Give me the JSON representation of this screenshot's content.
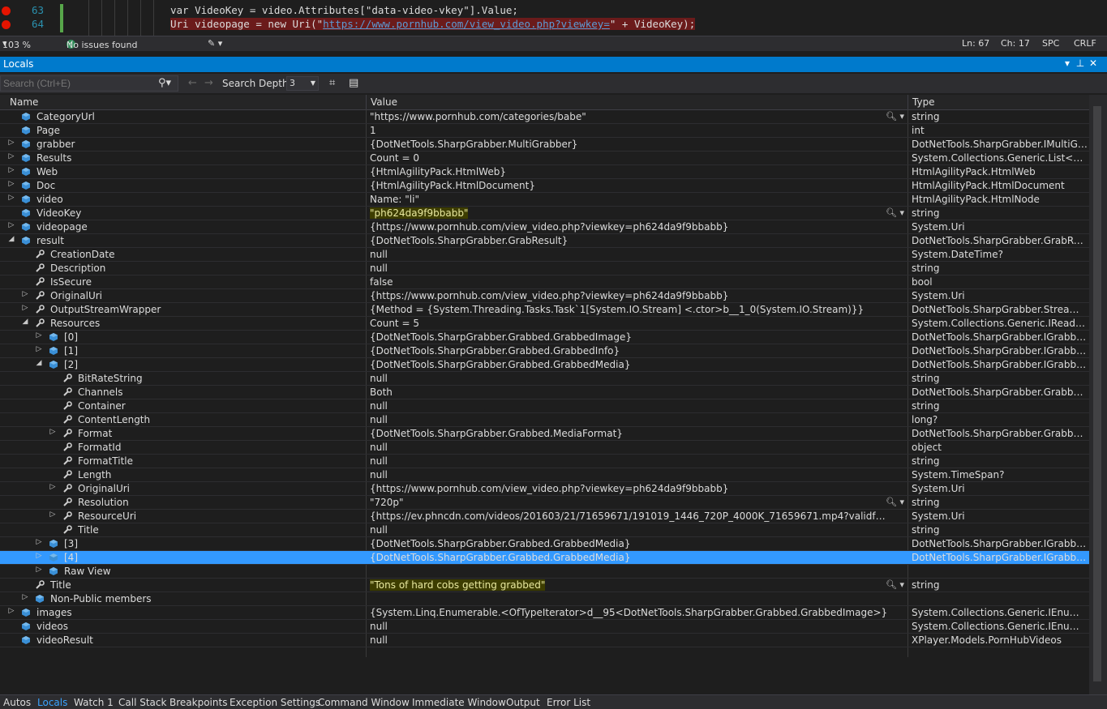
{
  "editor": {
    "lines": [
      {
        "num": "63",
        "code": "var VideoKey = video.Attributes[\"data-video-vkey\"].Value;"
      },
      {
        "num": "64",
        "code_prefix": "Uri videopage = new Uri(\"",
        "code_url": "https://www.pornhub.com/view_video.php?viewkey=",
        "code_suffix": "\" + VideoKey);"
      }
    ],
    "zoom": "103 %",
    "issues": "No issues found",
    "ln": "Ln: 67",
    "ch": "Ch: 17",
    "spc": "SPC",
    "crlf": "CRLF"
  },
  "locals": {
    "title": "Locals",
    "search_placeholder": "Search (Ctrl+E)",
    "search_depth_label": "Search Depth:",
    "search_depth_value": "3",
    "columns": {
      "name": "Name",
      "value": "Value",
      "type": "Type"
    },
    "rows": [
      {
        "name": "CategoryUrl",
        "value": "\"https://www.pornhub.com/categories/babe\"",
        "type": "string",
        "depth": 0,
        "expand": "",
        "icon": "field",
        "magnify": true
      },
      {
        "name": "Page",
        "value": "1",
        "type": "int",
        "depth": 0,
        "expand": "",
        "icon": "field"
      },
      {
        "name": "grabber",
        "value": "{DotNetTools.SharpGrabber.MultiGrabber}",
        "type": "DotNetTools.SharpGrabber.IMultiGrabb...",
        "depth": 0,
        "expand": "collapsed",
        "icon": "field"
      },
      {
        "name": "Results",
        "value": "Count = 0",
        "type": "System.Collections.Generic.List<XPlaye...",
        "depth": 0,
        "expand": "collapsed",
        "icon": "field"
      },
      {
        "name": "Web",
        "value": "{HtmlAgilityPack.HtmlWeb}",
        "type": "HtmlAgilityPack.HtmlWeb",
        "depth": 0,
        "expand": "collapsed",
        "icon": "field"
      },
      {
        "name": "Doc",
        "value": "{HtmlAgilityPack.HtmlDocument}",
        "type": "HtmlAgilityPack.HtmlDocument",
        "depth": 0,
        "expand": "collapsed",
        "icon": "field"
      },
      {
        "name": "video",
        "value": "Name: \"li\"",
        "type": "HtmlAgilityPack.HtmlNode",
        "depth": 0,
        "expand": "collapsed",
        "icon": "field"
      },
      {
        "name": "VideoKey",
        "value": "\"ph624da9f9bbabb\"",
        "type": "string",
        "depth": 0,
        "expand": "",
        "icon": "field",
        "magnify": true,
        "highlight": true
      },
      {
        "name": "videopage",
        "value": "{https://www.pornhub.com/view_video.php?viewkey=ph624da9f9bbabb}",
        "type": "System.Uri",
        "depth": 0,
        "expand": "collapsed",
        "icon": "field"
      },
      {
        "name": "result",
        "value": "{DotNetTools.SharpGrabber.GrabResult}",
        "type": "DotNetTools.SharpGrabber.GrabResult",
        "depth": 0,
        "expand": "expanded",
        "icon": "field"
      },
      {
        "name": "CreationDate",
        "value": "null",
        "type": "System.DateTime?",
        "depth": 1,
        "expand": "",
        "icon": "wrench"
      },
      {
        "name": "Description",
        "value": "null",
        "type": "string",
        "depth": 1,
        "expand": "",
        "icon": "wrench"
      },
      {
        "name": "IsSecure",
        "value": "false",
        "type": "bool",
        "depth": 1,
        "expand": "",
        "icon": "wrench"
      },
      {
        "name": "OriginalUri",
        "value": "{https://www.pornhub.com/view_video.php?viewkey=ph624da9f9bbabb}",
        "type": "System.Uri",
        "depth": 1,
        "expand": "collapsed",
        "icon": "wrench"
      },
      {
        "name": "OutputStreamWrapper",
        "value": "{Method = {System.Threading.Tasks.Task`1[System.IO.Stream] <.ctor>b__1_0(System.IO.Stream)}}",
        "type": "DotNetTools.SharpGrabber.StreamWrap...",
        "depth": 1,
        "expand": "collapsed",
        "icon": "wrench"
      },
      {
        "name": "Resources",
        "value": "Count = 5",
        "type": "System.Collections.Generic.IReadOnlyL...",
        "depth": 1,
        "expand": "expanded",
        "icon": "wrench"
      },
      {
        "name": "[0]",
        "value": "{DotNetTools.SharpGrabber.Grabbed.GrabbedImage}",
        "type": "DotNetTools.SharpGrabber.IGrabbed {D...",
        "depth": 2,
        "expand": "collapsed",
        "icon": "field"
      },
      {
        "name": "[1]",
        "value": "{DotNetTools.SharpGrabber.Grabbed.GrabbedInfo}",
        "type": "DotNetTools.SharpGrabber.IGrabbed {D...",
        "depth": 2,
        "expand": "collapsed",
        "icon": "field"
      },
      {
        "name": "[2]",
        "value": "{DotNetTools.SharpGrabber.Grabbed.GrabbedMedia}",
        "type": "DotNetTools.SharpGrabber.IGrabbed {D...",
        "depth": 2,
        "expand": "expanded",
        "icon": "field"
      },
      {
        "name": "BitRateString",
        "value": "null",
        "type": "string",
        "depth": 3,
        "expand": "",
        "icon": "wrench"
      },
      {
        "name": "Channels",
        "value": "Both",
        "type": "DotNetTools.SharpGrabber.Grabbed.Me...",
        "depth": 3,
        "expand": "",
        "icon": "wrench"
      },
      {
        "name": "Container",
        "value": "null",
        "type": "string",
        "depth": 3,
        "expand": "",
        "icon": "wrench"
      },
      {
        "name": "ContentLength",
        "value": "null",
        "type": "long?",
        "depth": 3,
        "expand": "",
        "icon": "wrench"
      },
      {
        "name": "Format",
        "value": "{DotNetTools.SharpGrabber.Grabbed.MediaFormat}",
        "type": "DotNetTools.SharpGrabber.Grabbed.Me...",
        "depth": 3,
        "expand": "collapsed",
        "icon": "wrench"
      },
      {
        "name": "FormatId",
        "value": "null",
        "type": "object",
        "depth": 3,
        "expand": "",
        "icon": "wrench"
      },
      {
        "name": "FormatTitle",
        "value": "null",
        "type": "string",
        "depth": 3,
        "expand": "",
        "icon": "wrench"
      },
      {
        "name": "Length",
        "value": "null",
        "type": "System.TimeSpan?",
        "depth": 3,
        "expand": "",
        "icon": "wrench"
      },
      {
        "name": "OriginalUri",
        "value": "{https://www.pornhub.com/view_video.php?viewkey=ph624da9f9bbabb}",
        "type": "System.Uri",
        "depth": 3,
        "expand": "collapsed",
        "icon": "wrench"
      },
      {
        "name": "Resolution",
        "value": "\"720p\"",
        "type": "string",
        "depth": 3,
        "expand": "",
        "icon": "wrench",
        "magnify": true
      },
      {
        "name": "ResourceUri",
        "value": "{https://ev.phncdn.com/videos/201603/21/71659671/191019_1446_720P_4000K_71659671.mp4?validfrom=1632770612&valid...",
        "type": "System.Uri",
        "depth": 3,
        "expand": "collapsed",
        "icon": "wrench"
      },
      {
        "name": "Title",
        "value": "null",
        "type": "string",
        "depth": 3,
        "expand": "",
        "icon": "wrench"
      },
      {
        "name": "[3]",
        "value": "{DotNetTools.SharpGrabber.Grabbed.GrabbedMedia}",
        "type": "DotNetTools.SharpGrabber.IGrabbed {D...",
        "depth": 2,
        "expand": "collapsed",
        "icon": "field"
      },
      {
        "name": "[4]",
        "value": "{DotNetTools.SharpGrabber.Grabbed.GrabbedMedia}",
        "type": "DotNetTools.SharpGrabber.IGrabbed {D...",
        "depth": 2,
        "expand": "collapsed",
        "icon": "field",
        "selected": true
      },
      {
        "name": "Raw View",
        "value": "",
        "type": "",
        "depth": 2,
        "expand": "collapsed",
        "icon": "field"
      },
      {
        "name": "Title",
        "value": "\"Tons of hard cobs getting grabbed\"",
        "type": "string",
        "depth": 1,
        "expand": "",
        "icon": "wrench",
        "magnify": true,
        "highlight": true
      },
      {
        "name": "Non-Public members",
        "value": "",
        "type": "",
        "depth": 1,
        "expand": "collapsed",
        "icon": "field"
      },
      {
        "name": "images",
        "value": "{System.Linq.Enumerable.<OfTypeIterator>d__95<DotNetTools.SharpGrabber.Grabbed.GrabbedImage>}",
        "type": "System.Collections.Generic.IEnumerabl...",
        "depth": 0,
        "expand": "collapsed",
        "icon": "field"
      },
      {
        "name": "videos",
        "value": "null",
        "type": "System.Collections.Generic.IEnumerabl...",
        "depth": 0,
        "expand": "",
        "icon": "field"
      },
      {
        "name": "videoResult",
        "value": "null",
        "type": "XPlayer.Models.PornHubVideos",
        "depth": 0,
        "expand": "",
        "icon": "field"
      }
    ]
  },
  "bottom_tabs": [
    "Autos",
    "Locals",
    "Watch 1",
    "Call Stack",
    "Breakpoints",
    "Exception Settings",
    "Command Window",
    "Immediate Window",
    "Output",
    "Error List"
  ],
  "active_tab": "Locals",
  "colors": {
    "accent": "#007acc",
    "selected_row": "#3399ff",
    "breakpoint": "#e51400"
  }
}
